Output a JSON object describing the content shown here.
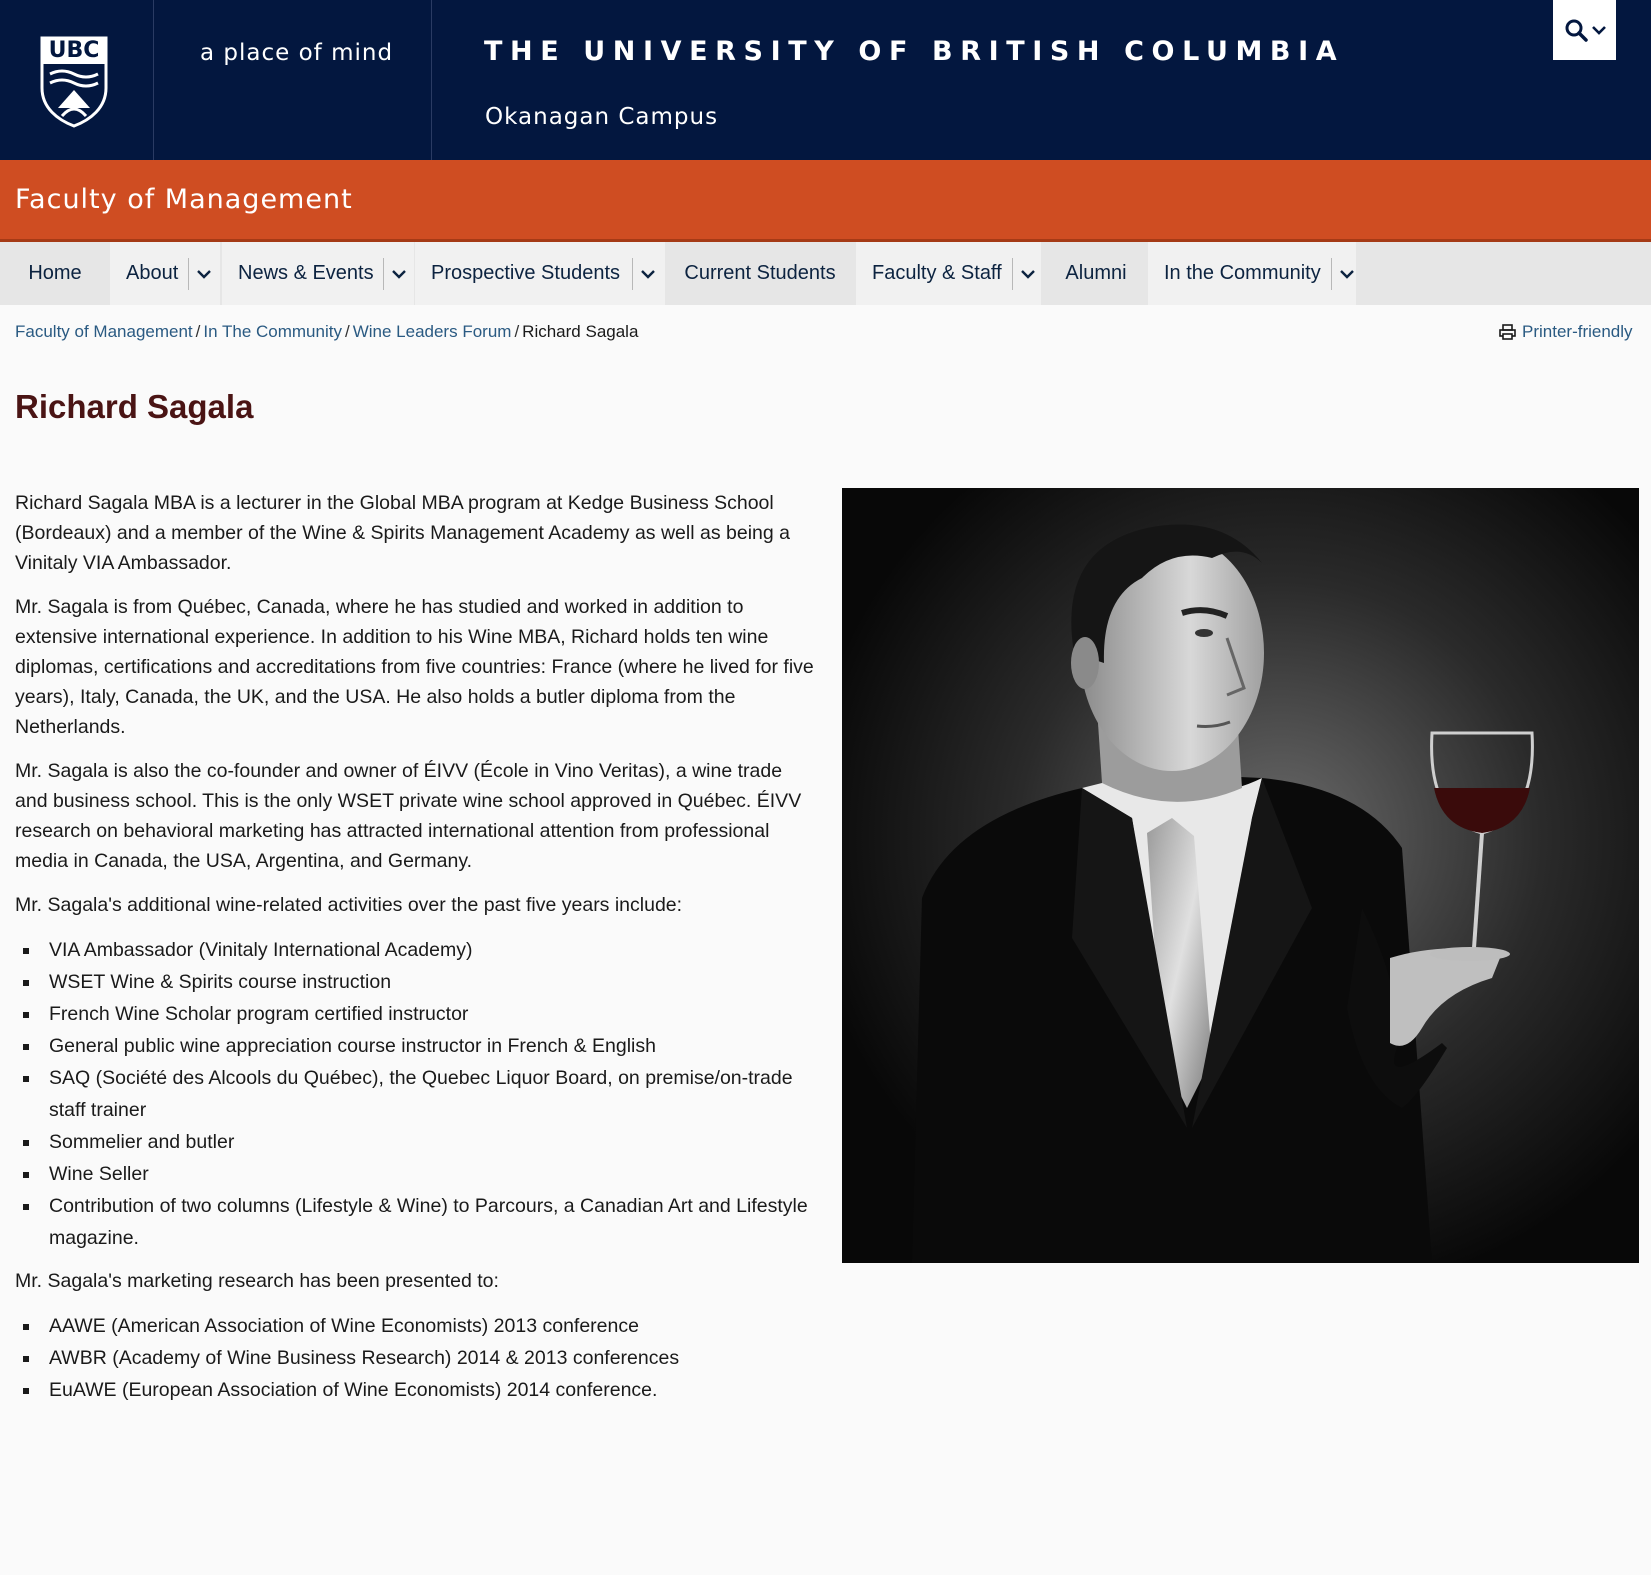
{
  "header": {
    "logo_text": "UBC",
    "tagline": "a place of mind",
    "university": "THE UNIVERSITY OF BRITISH COLUMBIA",
    "campus": "Okanagan Campus"
  },
  "faculty": {
    "title": "Faculty of Management"
  },
  "nav": {
    "items": [
      {
        "label": "Home"
      },
      {
        "label": "About"
      },
      {
        "label": "News & Events"
      },
      {
        "label": "Prospective Students"
      },
      {
        "label": "Current Students"
      },
      {
        "label": "Faculty & Staff"
      },
      {
        "label": "Alumni"
      },
      {
        "label": "In the Community"
      }
    ]
  },
  "breadcrumb": {
    "items": [
      "Faculty of Management",
      "In The Community",
      "Wine Leaders Forum"
    ],
    "current": "Richard Sagala",
    "separator": "/"
  },
  "printer_label": "Printer-friendly",
  "page": {
    "title": "Richard Sagala",
    "paragraphs": [
      "Richard Sagala MBA is a lecturer in the Global MBA program at Kedge Business School (Bordeaux) and a member of the Wine & Spirits Management Academy as well as being a Vinitaly VIA Ambassador.",
      "Mr. Sagala is from Québec, Canada, where he has studied and worked in addition to extensive international experience. In addition to his Wine MBA, Richard holds ten wine diplomas, certifications and accreditations from five countries: France (where he lived for five years), Italy, Canada, the UK, and the USA. He also holds a butler diploma from the Netherlands.",
      "Mr. Sagala is also the co-founder and owner of ÉIVV (École in Vino Veritas), a wine trade and business school. This is the only WSET private wine school approved in Québec. ÉIVV research on behavioral marketing has attracted international attention from professional media in Canada, the USA, Argentina, and Germany.",
      "Mr. Sagala's additional wine-related activities over the past five years include:"
    ],
    "activities": [
      "VIA Ambassador (Vinitaly International Academy)",
      "WSET Wine & Spirits course instruction",
      "French Wine Scholar program certified instructor",
      "General public wine appreciation course instructor in French & English",
      "SAQ (Société des Alcools du Québec), the Quebec Liquor Board, on premise/on-trade staff trainer",
      "Sommelier and butler",
      "Wine Seller",
      "Contribution of two columns (Lifestyle & Wine) to Parcours, a Canadian Art and Lifestyle magazine."
    ],
    "research_intro": "Mr. Sagala's marketing research has been presented to:",
    "research": [
      "AAWE (American Association of Wine Economists) 2013 conference",
      "AWBR (Academy of Wine Business Research) 2014 & 2013 conferences",
      "EuAWE (European Association of Wine Economists) 2014 conference."
    ]
  },
  "icons": {
    "search": "search-icon",
    "chevron": "chevron-down-icon",
    "printer": "printer-icon",
    "crest": "ubc-crest-icon"
  },
  "colors": {
    "header_bg": "#03173f",
    "faculty_bar": "#cf4d22",
    "nav_bg": "#e6e6e6",
    "title_color": "#4a1414",
    "link_color": "#2a5a82"
  }
}
